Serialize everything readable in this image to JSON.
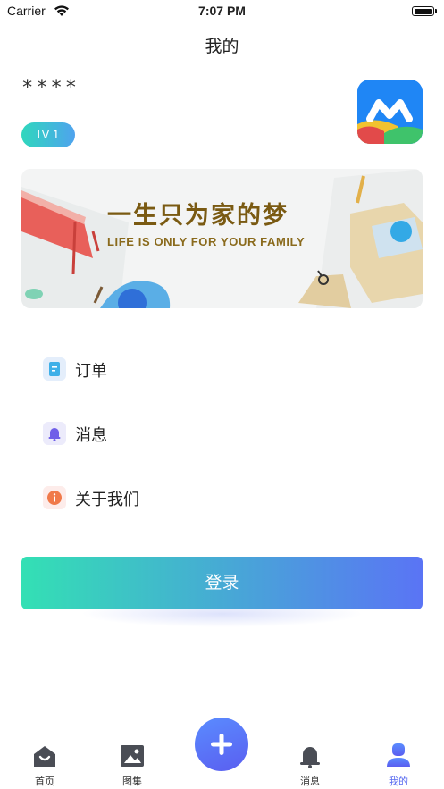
{
  "status_bar": {
    "carrier": "Carrier",
    "time": "7:07 PM"
  },
  "header": {
    "title": "我的"
  },
  "profile": {
    "username": "****",
    "level": "LV 1"
  },
  "banner": {
    "title": "一生只为家的梦",
    "subtitle": "LIFE IS ONLY FOR YOUR FAMILY"
  },
  "menu": {
    "items": [
      {
        "label": "订单",
        "icon": "order-icon"
      },
      {
        "label": "消息",
        "icon": "bell-icon"
      },
      {
        "label": "关于我们",
        "icon": "info-icon"
      }
    ]
  },
  "login": {
    "label": "登录"
  },
  "tabbar": {
    "items": [
      {
        "label": "首页",
        "icon": "home-icon"
      },
      {
        "label": "图集",
        "icon": "gallery-icon"
      },
      {
        "label": "",
        "icon": "plus-icon"
      },
      {
        "label": "消息",
        "icon": "bell-icon"
      },
      {
        "label": "我的",
        "icon": "user-icon",
        "active": true
      }
    ]
  },
  "colors": {
    "accent": "#5a6cf0",
    "gradient_start": "#33e0b4",
    "gradient_end": "#5a74f5"
  }
}
